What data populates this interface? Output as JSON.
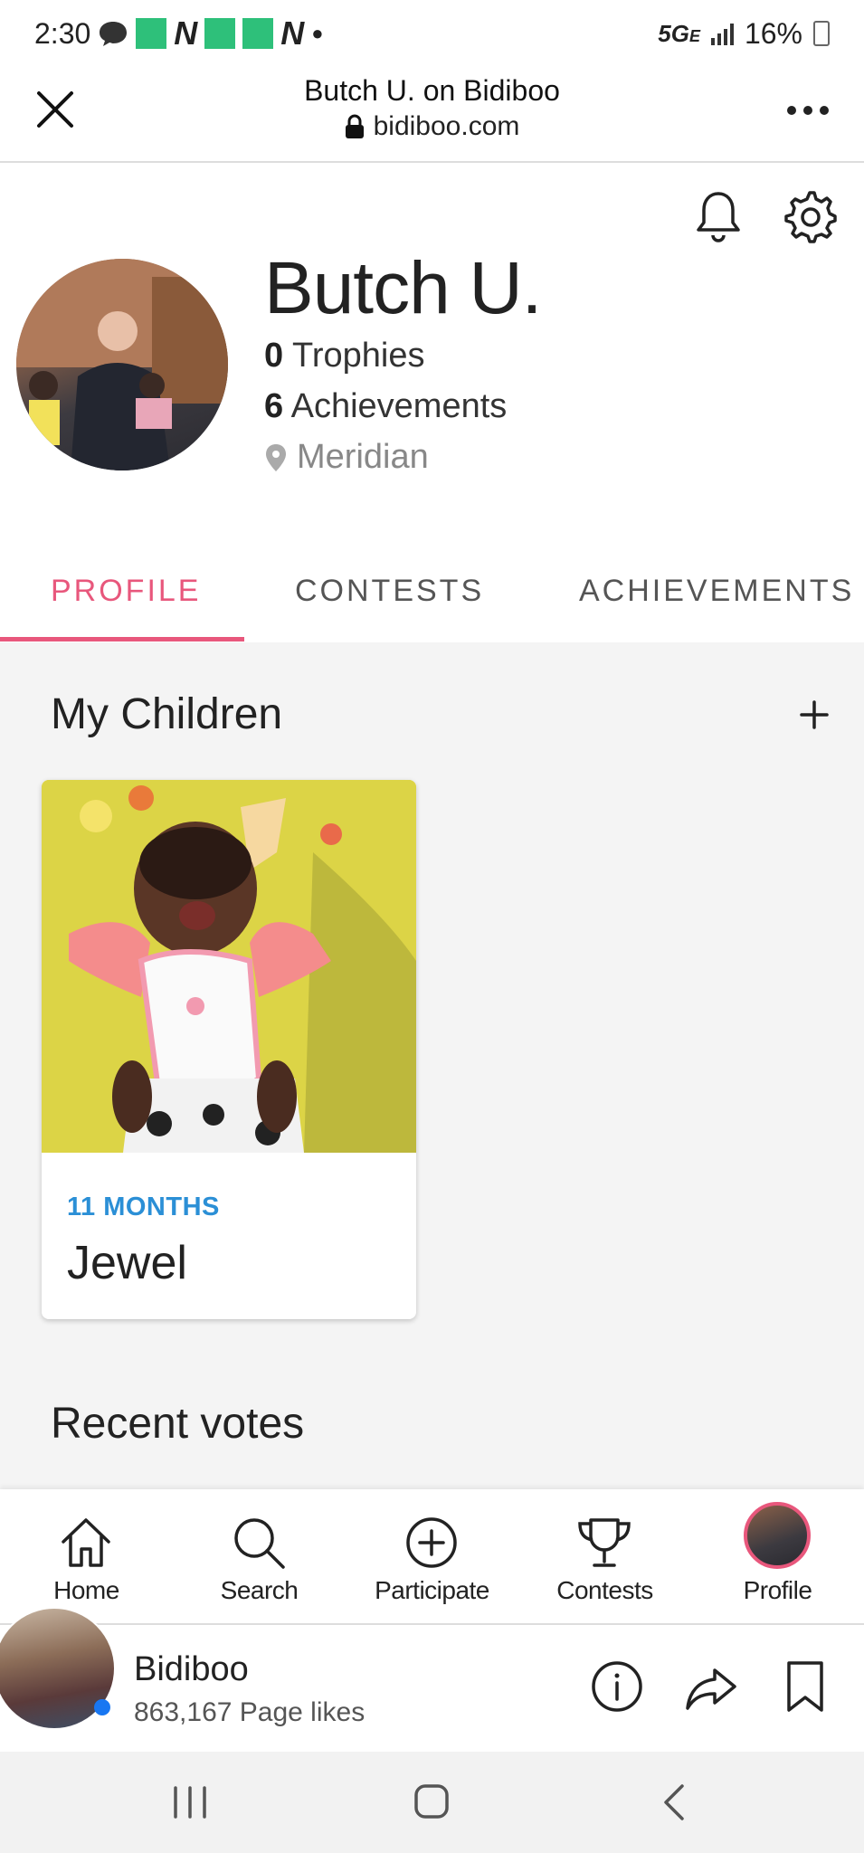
{
  "status_bar": {
    "time": "2:30",
    "network": "5G",
    "network_sub": "E",
    "battery": "16%"
  },
  "browser": {
    "title": "Butch U. on Bidiboo",
    "url": "bidiboo.com"
  },
  "profile": {
    "name": "Butch U.",
    "trophies_count": "0",
    "trophies_label": "Trophies",
    "achievements_count": "6",
    "achievements_label": "Achievements",
    "location": "Meridian"
  },
  "tabs": [
    {
      "label": "PROFILE",
      "active": true
    },
    {
      "label": "CONTESTS",
      "active": false
    },
    {
      "label": "ACHIEVEMENTS",
      "active": false
    }
  ],
  "children_section": {
    "title": "My Children",
    "children": [
      {
        "age": "11 MONTHS",
        "name": "Jewel"
      }
    ]
  },
  "recent_votes": {
    "title": "Recent votes"
  },
  "bottom_nav": [
    {
      "label": "Home",
      "icon": "home-icon"
    },
    {
      "label": "Search",
      "icon": "search-icon"
    },
    {
      "label": "Participate",
      "icon": "plus-circle-icon"
    },
    {
      "label": "Contests",
      "icon": "trophy-icon"
    },
    {
      "label": "Profile",
      "icon": "avatar"
    }
  ],
  "page_banner": {
    "name": "Bidiboo",
    "likes": "863,167 Page likes"
  },
  "colors": {
    "accent": "#e8577c",
    "age_blue": "#2b8fd6",
    "background": "#f4f4f4"
  }
}
